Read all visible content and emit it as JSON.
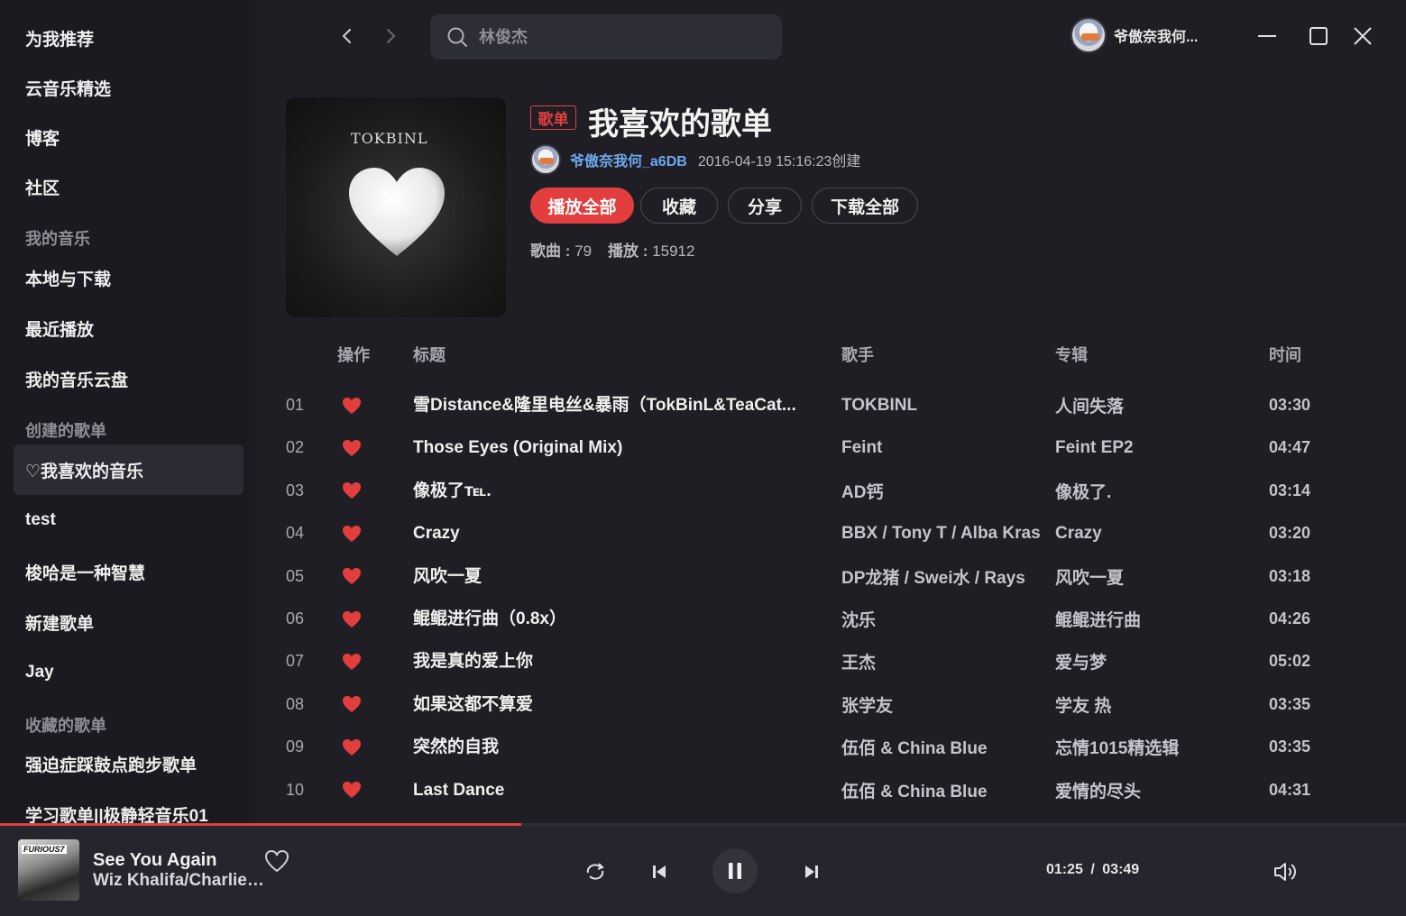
{
  "sidebar": {
    "items": [
      {
        "label": "为我推荐"
      },
      {
        "label": "云音乐精选"
      },
      {
        "label": "博客"
      },
      {
        "label": "社区"
      }
    ],
    "my_music_title": "我的音乐",
    "my_music": [
      {
        "label": "本地与下载"
      },
      {
        "label": "最近播放"
      },
      {
        "label": "我的音乐云盘"
      }
    ],
    "created_title": "创建的歌单",
    "created": [
      {
        "label": "♡我喜欢的音乐"
      },
      {
        "label": "test"
      },
      {
        "label": "梭哈是一种智慧"
      },
      {
        "label": "新建歌单"
      },
      {
        "label": "Jay"
      }
    ],
    "collected_title": "收藏的歌单",
    "collected": [
      {
        "label": "强迫症踩鼓点跑步歌单"
      },
      {
        "label": "学习歌单||极静轻音乐01"
      }
    ]
  },
  "search": {
    "placeholder": "林俊杰"
  },
  "user": {
    "name": "爷傲奈我何..."
  },
  "playlist": {
    "tag": "歌单",
    "title": "我喜欢的歌单",
    "cover_text": "TOKBINL",
    "creator": "爷傲奈我何_a6DB",
    "created_at": "2016-04-19 15:16:23创建",
    "buttons": {
      "play_all": "播放全部",
      "collect": "收藏",
      "share": "分享",
      "download_all": "下载全部"
    },
    "songs_label": "歌曲 :",
    "songs_count": "79",
    "plays_label": "播放 :",
    "plays_count": "15912"
  },
  "table": {
    "headers": {
      "action": "操作",
      "title": "标题",
      "artist": "歌手",
      "album": "专辑",
      "duration": "时间"
    },
    "rows": [
      {
        "num": "01",
        "title": "雪Distance&隆里电丝&暴雨（TokBinL&TeaCat...",
        "artist": "TOKBINL",
        "album": "人间失落",
        "duration": "03:30"
      },
      {
        "num": "02",
        "title": "Those Eyes (Original Mix)",
        "artist": "Feint",
        "album": "Feint EP2",
        "duration": "04:47"
      },
      {
        "num": "03",
        "title": "像极了℡.",
        "artist": "AD钙",
        "album": "像极了.",
        "duration": "03:14"
      },
      {
        "num": "04",
        "title": "Crazy",
        "artist": "BBX / Tony T / Alba Kras",
        "album": "Crazy",
        "duration": "03:20"
      },
      {
        "num": "05",
        "title": "风吹一夏",
        "artist": "DP龙猪 / Swei水 / Rays",
        "album": "风吹一夏",
        "duration": "03:18"
      },
      {
        "num": "06",
        "title": "鲲鲲进行曲（0.8x）",
        "artist": "沈乐",
        "album": "鲲鲲进行曲",
        "duration": "04:26"
      },
      {
        "num": "07",
        "title": "我是真的爱上你",
        "artist": "王杰",
        "album": "爱与梦",
        "duration": "05:02"
      },
      {
        "num": "08",
        "title": "如果这都不算爱",
        "artist": "张学友",
        "album": "学友 热",
        "duration": "03:35"
      },
      {
        "num": "09",
        "title": "突然的自我",
        "artist": "伍佰 & China Blue",
        "album": "忘情1015精选辑",
        "duration": "03:35"
      },
      {
        "num": "10",
        "title": "Last Dance",
        "artist": "伍佰 & China Blue",
        "album": "爱情的尽头",
        "duration": "04:31"
      }
    ]
  },
  "player": {
    "cover_label": "FURIOUS7",
    "title": "See You Again",
    "artist": "Wiz Khalifa/Charlie Puth",
    "current_time": "01:25",
    "separator": "/",
    "total_time": "03:49",
    "progress": 0.371
  },
  "colors": {
    "accent": "#e33e3e",
    "link": "#6ea8f0",
    "bg": "#1e1e24",
    "sidebar": "#1a1a20"
  }
}
